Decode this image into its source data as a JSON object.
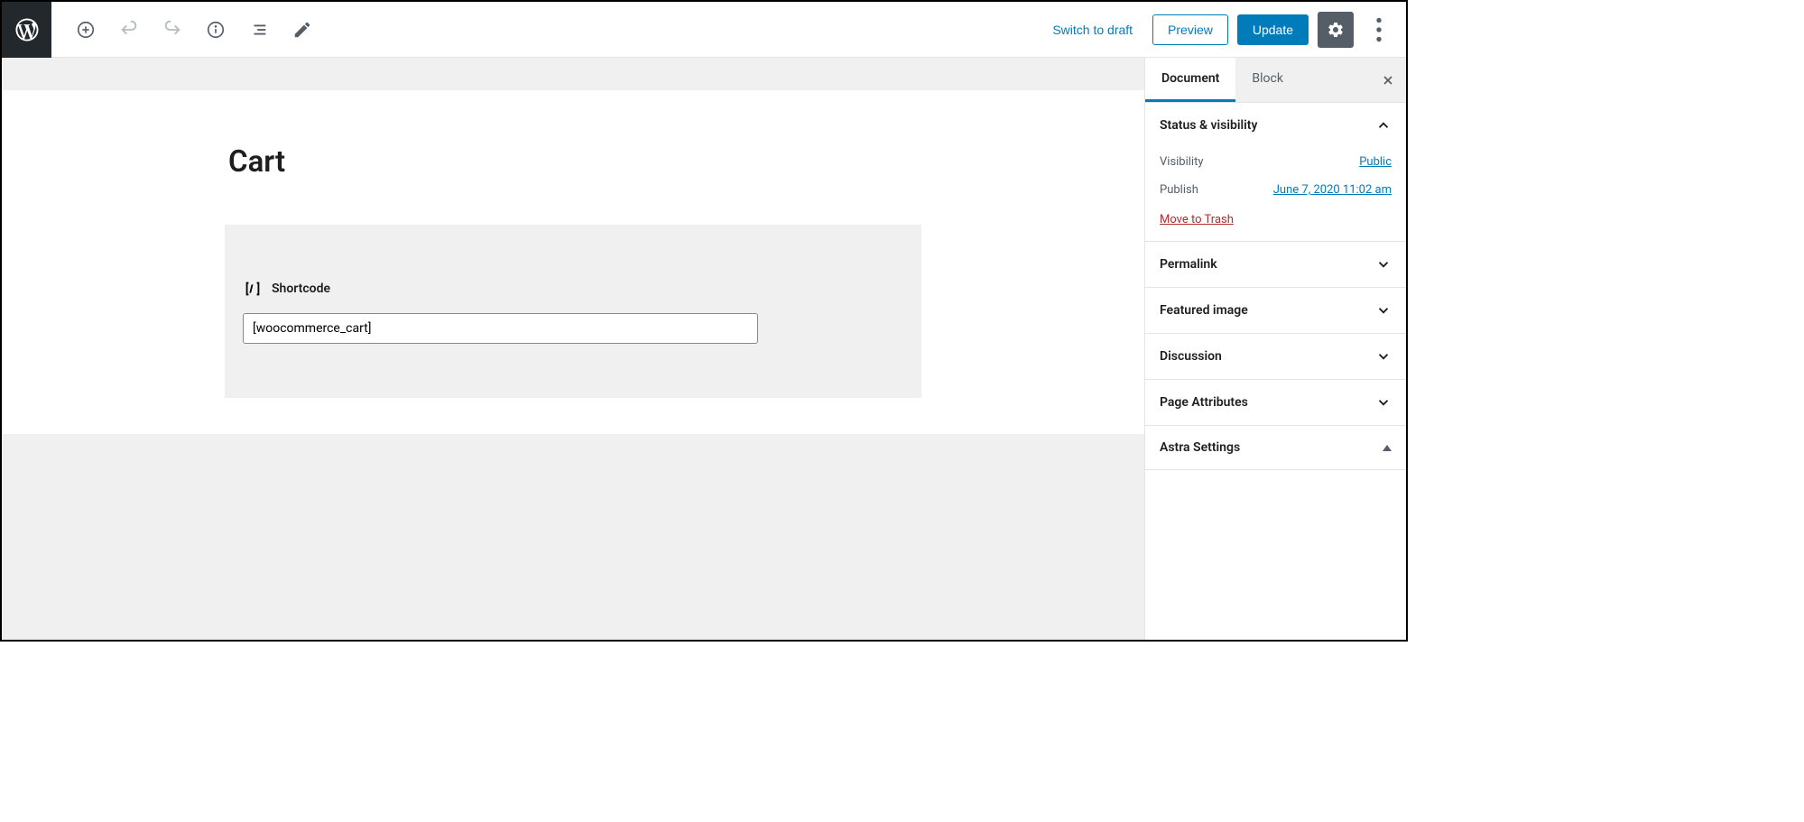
{
  "header": {
    "switch_to_draft": "Switch to draft",
    "preview": "Preview",
    "update": "Update"
  },
  "editor": {
    "title": "Cart",
    "shortcode_label": "Shortcode",
    "shortcode_value": "[woocommerce_cart]"
  },
  "sidebar": {
    "tabs": {
      "document": "Document",
      "block": "Block"
    },
    "status_visibility": {
      "title": "Status & visibility",
      "visibility_label": "Visibility",
      "visibility_value": "Public",
      "publish_label": "Publish",
      "publish_value": "June 7, 2020 11:02 am",
      "trash": "Move to Trash"
    },
    "panels": {
      "permalink": "Permalink",
      "featured_image": "Featured image",
      "discussion": "Discussion",
      "page_attributes": "Page Attributes",
      "astra_settings": "Astra Settings"
    }
  }
}
